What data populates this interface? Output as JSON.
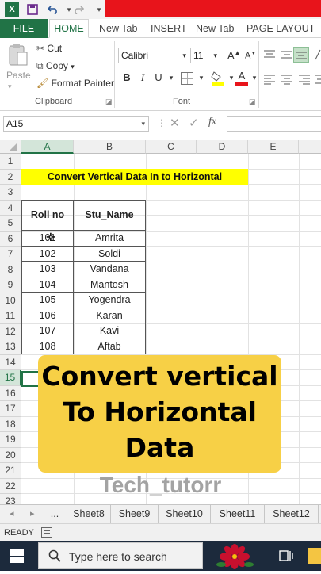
{
  "quick_access": {
    "excel_icon": "excel-icon",
    "save_icon": "save-icon",
    "undo_icon": "undo-icon",
    "redo_icon": "redo-icon"
  },
  "ribbon_tabs": [
    "FILE",
    "HOME",
    "New Tab",
    "INSERT",
    "New Tab",
    "PAGE LAYOUT"
  ],
  "clipboard": {
    "paste": "Paste",
    "cut": "Cut",
    "copy": "Copy",
    "format_painter": "Format Painter",
    "group_label": "Clipboard"
  },
  "font": {
    "name": "Calibri",
    "size": "11",
    "bold": "B",
    "italic": "I",
    "underline": "U",
    "grow": "A",
    "shrink": "A",
    "group_label": "Font"
  },
  "formula_bar": {
    "name_box": "A15",
    "fx": "fx",
    "value": ""
  },
  "columns": [
    "A",
    "B",
    "C",
    "D",
    "E"
  ],
  "rows": [
    "1",
    "2",
    "3",
    "4",
    "5",
    "6",
    "7",
    "8",
    "9",
    "10",
    "11",
    "12",
    "13",
    "14",
    "15",
    "16",
    "17",
    "18",
    "19",
    "20",
    "21",
    "22",
    "23"
  ],
  "sheet": {
    "title": "Convert Vertical Data In to Horizontal",
    "headers": [
      "Roll no",
      "Stu_Name"
    ],
    "records": [
      [
        "101",
        "Amrita"
      ],
      [
        "102",
        "Soldi"
      ],
      [
        "103",
        "Vandana"
      ],
      [
        "104",
        "Mantosh"
      ],
      [
        "105",
        "Yogendra"
      ],
      [
        "106",
        "Karan"
      ],
      [
        "107",
        "Kavi"
      ],
      [
        "108",
        "Aftab"
      ]
    ]
  },
  "overlay": {
    "line1": "Convert vertical",
    "line2": "To Horizontal",
    "line3": "Data",
    "watermark": "Tech_tutorr",
    "color": "#f7d046"
  },
  "sheet_tabs": [
    "Sheet8",
    "Sheet9",
    "Sheet10",
    "Sheet11",
    "Sheet12"
  ],
  "sheet_nav": {
    "more": "..."
  },
  "status": {
    "ready": "READY"
  },
  "taskbar": {
    "search_placeholder": "Type here to search"
  },
  "colors": {
    "excel_green": "#217346",
    "title_fill": "#ffff00",
    "taskbar": "#1c2a3c"
  }
}
